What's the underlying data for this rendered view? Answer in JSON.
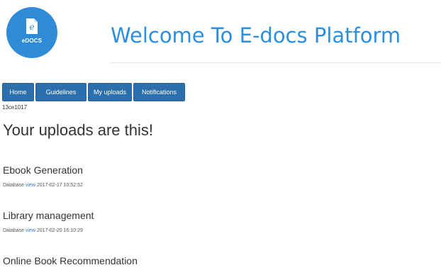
{
  "header": {
    "logo_text": "eDOCS",
    "title": "Welcome To E-docs Platform"
  },
  "nav": {
    "items": [
      {
        "label": "Home"
      },
      {
        "label": "Guidelines"
      },
      {
        "label": "My uploads"
      },
      {
        "label": "Notifications"
      }
    ]
  },
  "user": {
    "code": "13ce1017"
  },
  "main": {
    "heading": "Your uploads are this!",
    "uploads": [
      {
        "title": "Ebook Generation",
        "category": "Database",
        "link_text": "view",
        "timestamp": "2017-02-17 10:52:52"
      },
      {
        "title": "Library management",
        "category": "Database",
        "link_text": "view",
        "timestamp": "2017-02-20 16:10:29"
      },
      {
        "title": "Online Book Recommendation"
      }
    ]
  },
  "colors": {
    "brand_blue": "#2b8fde",
    "nav_blue": "#2c6fad",
    "link_blue": "#2b7bc0"
  }
}
